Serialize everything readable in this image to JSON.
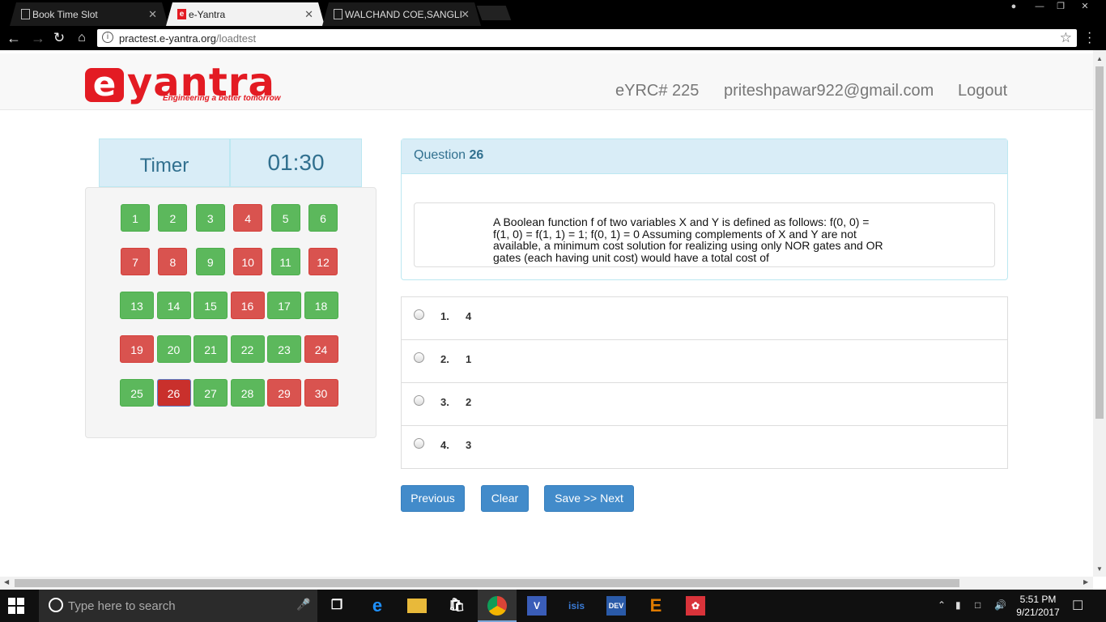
{
  "browser": {
    "tabs": [
      {
        "title": "Book Time Slot"
      },
      {
        "title": "e-Yantra"
      },
      {
        "title": "WALCHAND COE,SANGLI"
      }
    ],
    "url_host": "practest.e-yantra.org",
    "url_path": "/loadtest"
  },
  "site": {
    "logo_e": "e",
    "logo_word": "yantra",
    "logo_tagline": "Engineering a better tomorrow",
    "team": "eYRC# 225",
    "email": "priteshpawar922@gmail.com",
    "logout": "Logout"
  },
  "timer": {
    "label": "Timer",
    "value": "01:30"
  },
  "question_nav": [
    {
      "n": "1",
      "status": "green"
    },
    {
      "n": "2",
      "status": "green"
    },
    {
      "n": "3",
      "status": "green"
    },
    {
      "n": "4",
      "status": "red"
    },
    {
      "n": "5",
      "status": "green"
    },
    {
      "n": "6",
      "status": "green"
    },
    {
      "n": "7",
      "status": "red"
    },
    {
      "n": "8",
      "status": "red"
    },
    {
      "n": "9",
      "status": "green"
    },
    {
      "n": "10",
      "status": "red"
    },
    {
      "n": "11",
      "status": "green"
    },
    {
      "n": "12",
      "status": "red"
    },
    {
      "n": "13",
      "status": "green"
    },
    {
      "n": "14",
      "status": "green"
    },
    {
      "n": "15",
      "status": "green"
    },
    {
      "n": "16",
      "status": "red"
    },
    {
      "n": "17",
      "status": "green"
    },
    {
      "n": "18",
      "status": "green"
    },
    {
      "n": "19",
      "status": "red"
    },
    {
      "n": "20",
      "status": "green"
    },
    {
      "n": "21",
      "status": "green"
    },
    {
      "n": "22",
      "status": "green"
    },
    {
      "n": "23",
      "status": "green"
    },
    {
      "n": "24",
      "status": "red"
    },
    {
      "n": "25",
      "status": "green"
    },
    {
      "n": "26",
      "status": "current"
    },
    {
      "n": "27",
      "status": "green"
    },
    {
      "n": "28",
      "status": "green"
    },
    {
      "n": "29",
      "status": "red"
    },
    {
      "n": "30",
      "status": "red"
    }
  ],
  "question": {
    "label": "Question",
    "number": "26",
    "text_lines": [
      "A Boolean function f of two variables X and Y is defined as follows:  f(0, 0) =",
      "f(1, 0) = f(1, 1) = 1; f(0,  1) = 0 Assuming complements of X and Y are not",
      "available, a minimum cost solution for realizing using only  NOR gates and OR",
      "gates (each having unit cost) would have a total cost of"
    ]
  },
  "options": [
    {
      "num": "1.",
      "value": "4"
    },
    {
      "num": "2.",
      "value": "1"
    },
    {
      "num": "3.",
      "value": "2"
    },
    {
      "num": "4.",
      "value": "3"
    }
  ],
  "actions": {
    "previous": "Previous",
    "clear": "Clear",
    "save_next": "Save >> Next"
  },
  "taskbar": {
    "search_placeholder": "Type here to search",
    "time": "5:51 PM",
    "date": "9/21/2017"
  },
  "colors": {
    "answered": "#5cb85c",
    "unanswered": "#d9534f",
    "current": "#c9302c",
    "primary": "#428bca",
    "brand": "#e31b23"
  }
}
